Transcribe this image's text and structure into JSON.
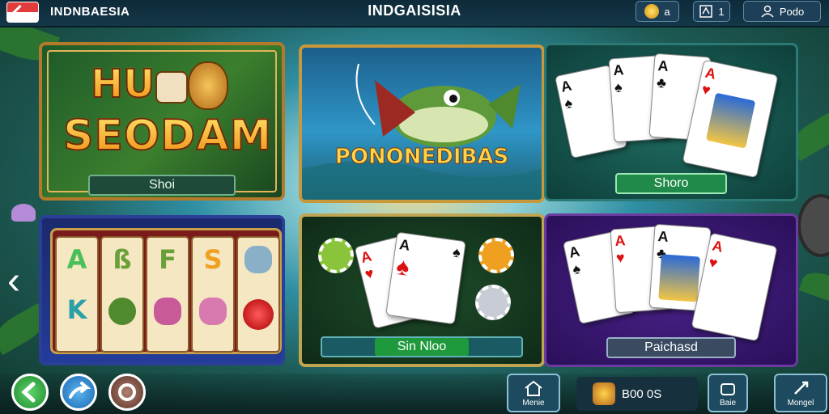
{
  "header": {
    "brand": "INDNBAESIA",
    "title": "INDGAISISIA",
    "pill_1": "a",
    "pill_2": "1",
    "pill_3": "Podo"
  },
  "games": [
    {
      "label": "Shoi",
      "title_line_1": "HU",
      "title_line_2": "SEODAM"
    },
    {
      "label": "",
      "title": "PONONEDIBAS"
    },
    {
      "label": "Shoro"
    },
    {
      "label": ""
    },
    {
      "label": "Sin Nloo"
    },
    {
      "label": "Paichasd"
    }
  ],
  "bottom": {
    "home_label": "Menie",
    "coins": "B00 0S",
    "btn2_label": "Baie",
    "btn3_label": "Mongel"
  },
  "colors": {
    "accent": "#ffd34a",
    "brand_red": "#e23b3b",
    "back_button": "#2fb34a",
    "share_button": "#2a8fd6",
    "record_button": "#7a4a3a"
  },
  "icons": [
    "back-arrow-icon",
    "coin-icon",
    "grid-icon",
    "user-icon",
    "home-icon",
    "chest-icon",
    "settings-icon",
    "chevron-left-icon",
    "share-icon",
    "record-icon"
  ]
}
